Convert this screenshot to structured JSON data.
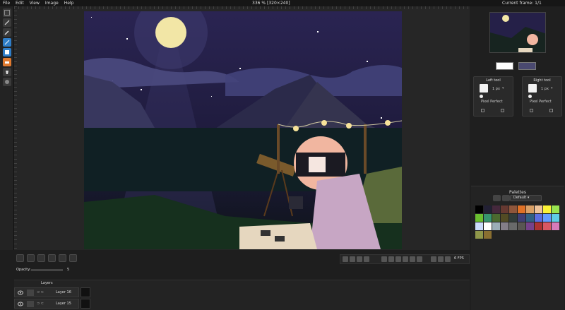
{
  "menu": [
    "File",
    "Edit",
    "View",
    "Image",
    "Help"
  ],
  "status": {
    "zoom": "336 %",
    "size": "[320×240]",
    "frame": "Current frame: 1/1"
  },
  "tools": [
    {
      "icon": "rect-select-icon",
      "color": "#3a3a3a"
    },
    {
      "icon": "pencil-icon",
      "color": "#3a3a3a"
    },
    {
      "icon": "brush-icon",
      "color": "#2f7ec8"
    },
    {
      "icon": "line-icon",
      "color": "#2f7ec8"
    },
    {
      "icon": "eraser-icon",
      "color": "#e07a2f"
    },
    {
      "icon": "bucket-icon",
      "color": "#3a3a3a"
    },
    {
      "icon": "shading-icon",
      "color": "#3a3a3a"
    }
  ],
  "colors": {
    "left": "#ffffff",
    "right": "#4a4970"
  },
  "left_tool": {
    "title": "Left tool",
    "size": "1 px",
    "pixel_perfect": "Pixel Perfect"
  },
  "right_tool": {
    "title": "Right tool",
    "size": "1 px",
    "pixel_perfect": "Pixel Perfect"
  },
  "palettes": {
    "title": "Palettes",
    "selected": "Default",
    "swatches": [
      "#000000",
      "#222034",
      "#45283c",
      "#663931",
      "#8f563b",
      "#df7126",
      "#d9a066",
      "#eec39a",
      "#fbf236",
      "#99e550",
      "#6abe30",
      "#37946e",
      "#4b692f",
      "#524b24",
      "#323c39",
      "#3f3f74",
      "#306082",
      "#5b6ee1",
      "#639bff",
      "#5fcde4",
      "#cbdbfc",
      "#ffffff",
      "#9badb7",
      "#847e87",
      "#696a6a",
      "#595652",
      "#76428a",
      "#ac3232",
      "#d95763",
      "#d77bba",
      "#8f974a",
      "#8a6f30"
    ]
  },
  "layers": {
    "title": "Layers",
    "rows": [
      {
        "name": "Layer 16"
      },
      {
        "name": "Layer 15"
      }
    ],
    "opacity_label": "Opacity:",
    "opacity_value": "5"
  },
  "animation": {
    "fps": "6 FPS"
  }
}
